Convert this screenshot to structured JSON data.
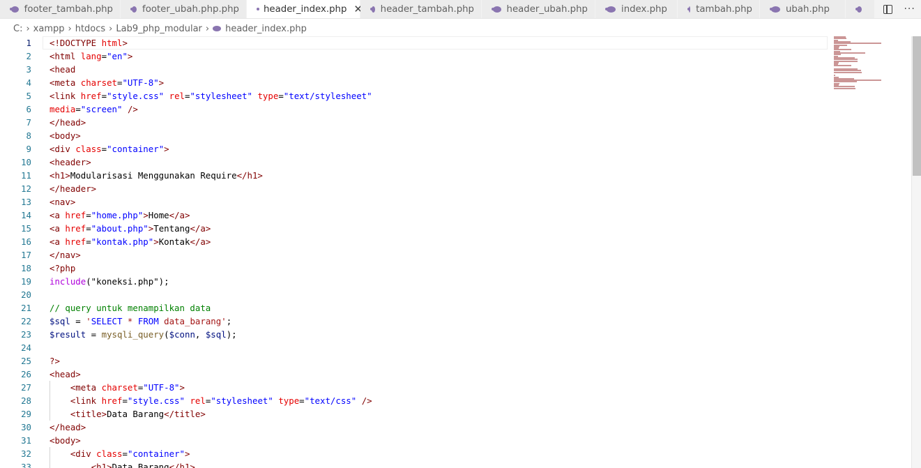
{
  "tabs": [
    {
      "label": "footer_tambah.php",
      "active": false
    },
    {
      "label": "footer_ubah.php.php",
      "active": false
    },
    {
      "label": "header_index.php",
      "active": true
    },
    {
      "label": "header_tambah.php",
      "active": false
    },
    {
      "label": "header_ubah.php",
      "active": false
    },
    {
      "label": "index.php",
      "active": false
    },
    {
      "label": "tambah.php",
      "active": false
    },
    {
      "label": "ubah.php",
      "active": false
    },
    {
      "label": "",
      "active": false
    }
  ],
  "breadcrumb": [
    "C:",
    "xampp",
    "htdocs",
    "Lab9_php_modular",
    "header_index.php"
  ],
  "current_line": 1,
  "code_lines": [
    [
      [
        "tag",
        "<!DOCTYPE "
      ],
      [
        "attr",
        "html"
      ],
      [
        "tag",
        ">"
      ]
    ],
    [
      [
        "tag",
        "<html "
      ],
      [
        "attr",
        "lang"
      ],
      [
        "txt",
        "="
      ],
      [
        "str",
        "\"en\""
      ],
      [
        "tag",
        ">"
      ]
    ],
    [
      [
        "tag",
        "<head"
      ]
    ],
    [
      [
        "tag",
        "<meta "
      ],
      [
        "attr",
        "charset"
      ],
      [
        "txt",
        "="
      ],
      [
        "str",
        "\"UTF-8\""
      ],
      [
        "tag",
        ">"
      ]
    ],
    [
      [
        "tag",
        "<link "
      ],
      [
        "attr",
        "href"
      ],
      [
        "txt",
        "="
      ],
      [
        "str",
        "\"style.css\""
      ],
      [
        "txt",
        " "
      ],
      [
        "attr",
        "rel"
      ],
      [
        "txt",
        "="
      ],
      [
        "str",
        "\"stylesheet\""
      ],
      [
        "txt",
        " "
      ],
      [
        "attr",
        "type"
      ],
      [
        "txt",
        "="
      ],
      [
        "str",
        "\"text/stylesheet\""
      ]
    ],
    [
      [
        "attr",
        "media"
      ],
      [
        "txt",
        "="
      ],
      [
        "str",
        "\"screen\""
      ],
      [
        "txt",
        " "
      ],
      [
        "tag",
        "/>"
      ]
    ],
    [
      [
        "tag",
        "</head>"
      ]
    ],
    [
      [
        "tag",
        "<body>"
      ]
    ],
    [
      [
        "tag",
        "<div "
      ],
      [
        "attr",
        "class"
      ],
      [
        "txt",
        "="
      ],
      [
        "str",
        "\"container\""
      ],
      [
        "tag",
        ">"
      ]
    ],
    [
      [
        "tag",
        "<header>"
      ]
    ],
    [
      [
        "tag",
        "<h1>"
      ],
      [
        "txt",
        "Modularisasi Menggunakan Require"
      ],
      [
        "tag",
        "</h1>"
      ]
    ],
    [
      [
        "tag",
        "</header>"
      ]
    ],
    [
      [
        "tag",
        "<nav>"
      ]
    ],
    [
      [
        "tag",
        "<a "
      ],
      [
        "attr",
        "href"
      ],
      [
        "txt",
        "="
      ],
      [
        "str",
        "\"home.php\""
      ],
      [
        "tag",
        ">"
      ],
      [
        "txt",
        "Home"
      ],
      [
        "tag",
        "</a>"
      ]
    ],
    [
      [
        "tag",
        "<a "
      ],
      [
        "attr",
        "href"
      ],
      [
        "txt",
        "="
      ],
      [
        "str",
        "\"about.php\""
      ],
      [
        "tag",
        ">"
      ],
      [
        "txt",
        "Tentang"
      ],
      [
        "tag",
        "</a>"
      ]
    ],
    [
      [
        "tag",
        "<a "
      ],
      [
        "attr",
        "href"
      ],
      [
        "txt",
        "="
      ],
      [
        "str",
        "\"kontak.php\""
      ],
      [
        "tag",
        ">"
      ],
      [
        "txt",
        "Kontak"
      ],
      [
        "tag",
        "</a>"
      ]
    ],
    [
      [
        "tag",
        "</nav>"
      ]
    ],
    [
      [
        "tag",
        "<?php"
      ]
    ],
    [
      [
        "php",
        "include"
      ],
      [
        "txt",
        "(\"koneksi.php\");"
      ]
    ],
    [],
    [
      [
        "cmt",
        "// query untuk menampilkan data"
      ]
    ],
    [
      [
        "var",
        "$sql"
      ],
      [
        "txt",
        " = "
      ],
      [
        "sqlstr",
        "'"
      ],
      [
        "kw",
        "SELECT"
      ],
      [
        "sqlstr",
        " * "
      ],
      [
        "kw",
        "FROM"
      ],
      [
        "sqlstr",
        " data_barang"
      ],
      [
        "sqlstr",
        "'"
      ],
      [
        "txt",
        ";"
      ]
    ],
    [
      [
        "var",
        "$result"
      ],
      [
        "txt",
        " = "
      ],
      [
        "fn",
        "mysqli_query"
      ],
      [
        "txt",
        "("
      ],
      [
        "var",
        "$conn"
      ],
      [
        "txt",
        ", "
      ],
      [
        "var",
        "$sql"
      ],
      [
        "txt",
        ");"
      ]
    ],
    [],
    [
      [
        "tag",
        "?>"
      ]
    ],
    [
      [
        "tag",
        "<head>"
      ]
    ],
    [
      [
        "txt",
        "    "
      ],
      [
        "tag",
        "<meta "
      ],
      [
        "attr",
        "charset"
      ],
      [
        "txt",
        "="
      ],
      [
        "str",
        "\"UTF-8\""
      ],
      [
        "tag",
        ">"
      ]
    ],
    [
      [
        "txt",
        "    "
      ],
      [
        "tag",
        "<link "
      ],
      [
        "attr",
        "href"
      ],
      [
        "txt",
        "="
      ],
      [
        "str",
        "\"style.css\""
      ],
      [
        "txt",
        " "
      ],
      [
        "attr",
        "rel"
      ],
      [
        "txt",
        "="
      ],
      [
        "str",
        "\"stylesheet\""
      ],
      [
        "txt",
        " "
      ],
      [
        "attr",
        "type"
      ],
      [
        "txt",
        "="
      ],
      [
        "str",
        "\"text/css\""
      ],
      [
        "txt",
        " "
      ],
      [
        "tag",
        "/>"
      ]
    ],
    [
      [
        "txt",
        "    "
      ],
      [
        "tag",
        "<title>"
      ],
      [
        "txt",
        "Data Barang"
      ],
      [
        "tag",
        "</title>"
      ]
    ],
    [
      [
        "tag",
        "</head>"
      ]
    ],
    [
      [
        "tag",
        "<body>"
      ]
    ],
    [
      [
        "txt",
        "    "
      ],
      [
        "tag",
        "<div "
      ],
      [
        "attr",
        "class"
      ],
      [
        "txt",
        "="
      ],
      [
        "str",
        "\"container\""
      ],
      [
        "tag",
        ">"
      ]
    ],
    [
      [
        "txt",
        "        "
      ],
      [
        "tag",
        "<h1>"
      ],
      [
        "txt",
        "Data Barang"
      ],
      [
        "tag",
        "</h1>"
      ]
    ]
  ]
}
